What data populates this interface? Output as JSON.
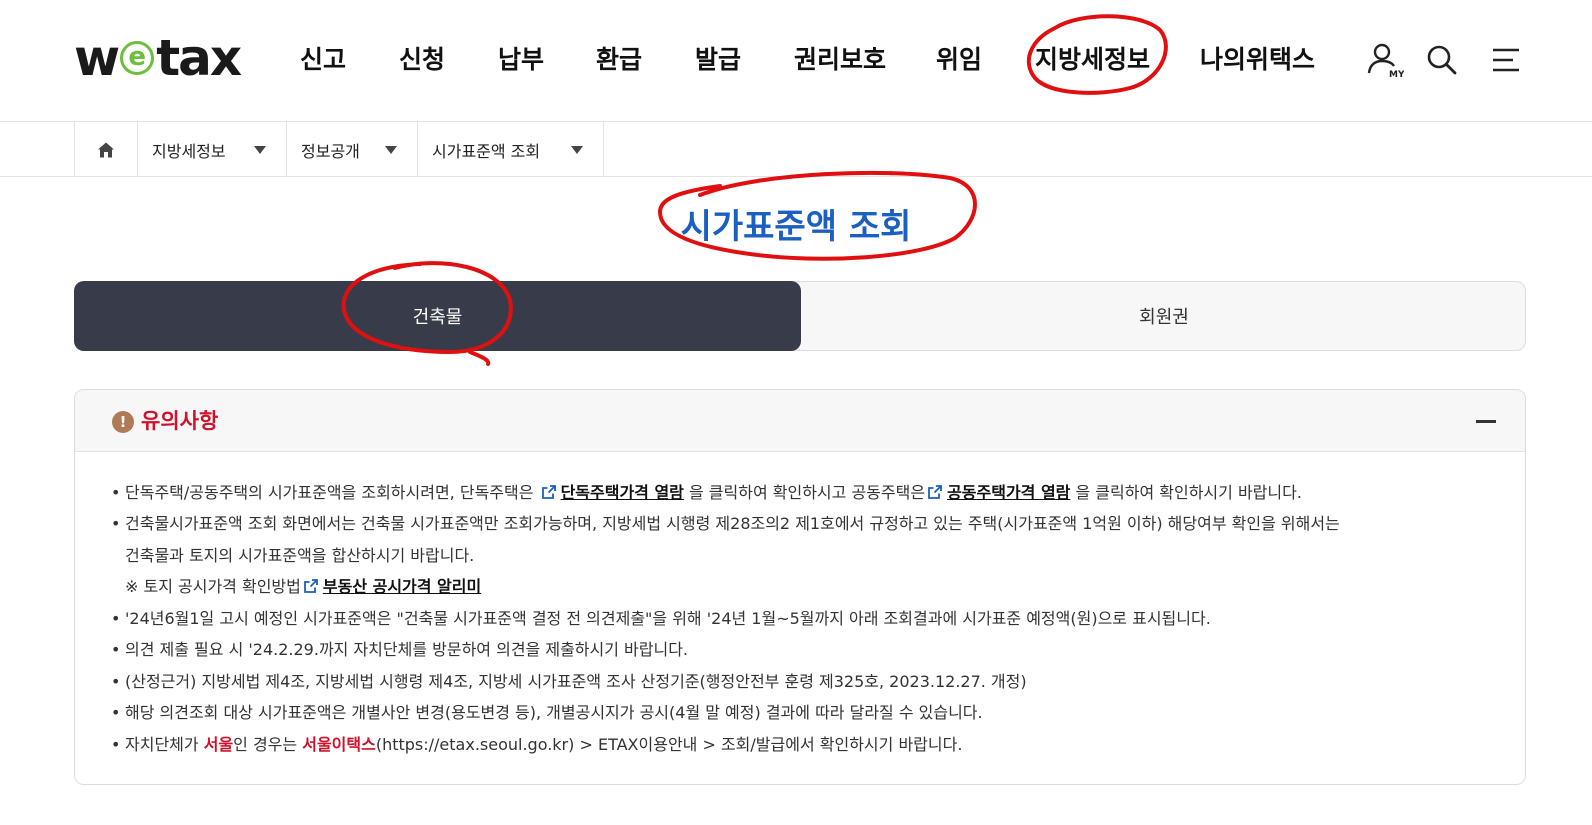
{
  "header": {
    "logo_pre": "w",
    "logo_e": "e",
    "logo_post": "tax",
    "nav": [
      "신고",
      "신청",
      "납부",
      "환급",
      "발급",
      "권리보호",
      "위임",
      "지방세정보",
      "나의위택스"
    ],
    "my_label": "MY"
  },
  "breadcrumb": {
    "items": [
      "지방세정보",
      "정보공개",
      "시가표준액 조회"
    ]
  },
  "page": {
    "title": "시가표준액 조회"
  },
  "tabs": [
    "건축물",
    "회원권"
  ],
  "notice": {
    "title": "유의사항",
    "icon_glyph": "!",
    "bullet": "•",
    "line1_a": "단독주택/공동주택의 시가표준액을 조회하시려면, 단독주택은",
    "line1_link1": "단독주택가격 열람",
    "line1_b": "을 클릭하여 확인하시고 공동주택은",
    "line1_link2": "공동주택가격 열람",
    "line1_c": "을 클릭하여 확인하시기 바랍니다.",
    "line2": "건축물시가표준액 조회 화면에서는 건축물 시가표준액만 조회가능하며, 지방세법 시행령 제28조의2 제1호에서 규정하고 있는 주택(시가표준액 1억원 이하) 해당여부 확인을 위해서는",
    "line3": "건축물과 토지의 시가표준액을 합산하시기 바랍니다.",
    "line4_a": "※  토지 공시가격 확인방법",
    "line4_link": "부동산 공시가격 알리미",
    "line5": "'24년6월1일 고시 예정인 시가표준액은 \"건축물 시가표준액 결정 전 의견제출\"을 위해 '24년 1월~5월까지 아래 조회결과에 시가표준 예정액(원)으로 표시됩니다.",
    "line6": "의견 제출 필요 시 '24.2.29.까지 자치단체를 방문하여 의견을 제출하시기 바랍니다.",
    "line7": "(산정근거) 지방세법 제4조, 지방세법 시행령 제4조, 지방세 시가표준액 조사 산정기준(행정안전부 훈령 제325호, 2023.12.27. 개정)",
    "line8": "해당 의견조회 대상 시가표준액은 개별사안 변경(용도변경 등), 개별공시지가 공시(4월 말 예정) 결과에 따라 달라질 수 있습니다.",
    "line9_a": "자치단체가",
    "line9_red1": "서울",
    "line9_b": "인 경우는",
    "line9_red2": "서울이택스",
    "line9_c": "(https://etax.seoul.go.kr) > ETAX이용안내 > 조회/발급에서 확인하시기 바랍니다."
  },
  "colors": {
    "title_blue": "#1b5fc1",
    "notice_red": "#d0112b",
    "tab_active_bg": "#383c4a",
    "annotation_red": "#e01010",
    "logo_green": "#6cbf3a"
  }
}
